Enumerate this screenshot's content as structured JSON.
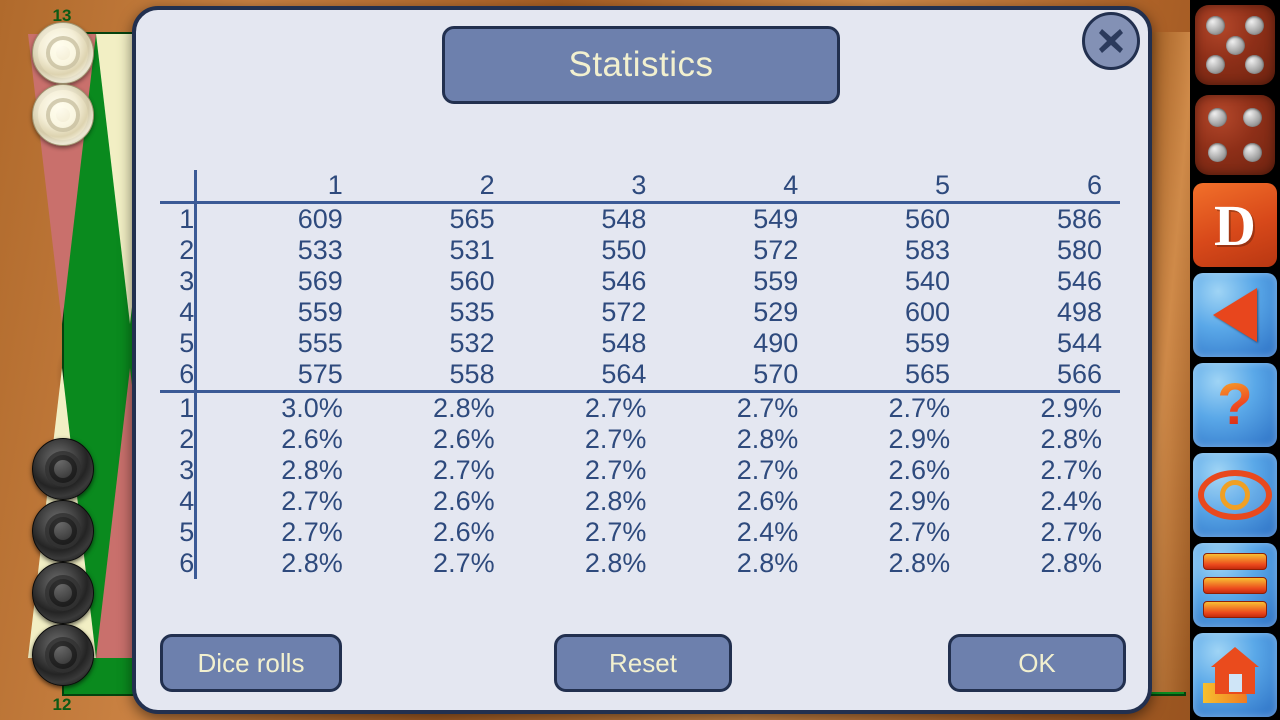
{
  "dialog": {
    "title": "Statistics",
    "close_icon": "close-x-icon"
  },
  "table": {
    "column_headers": [
      "1",
      "2",
      "3",
      "4",
      "5",
      "6"
    ],
    "row_headers": [
      "1",
      "2",
      "3",
      "4",
      "5",
      "6"
    ],
    "counts": [
      [
        "609",
        "565",
        "548",
        "549",
        "560",
        "586"
      ],
      [
        "533",
        "531",
        "550",
        "572",
        "583",
        "580"
      ],
      [
        "569",
        "560",
        "546",
        "559",
        "540",
        "546"
      ],
      [
        "559",
        "535",
        "572",
        "529",
        "600",
        "498"
      ],
      [
        "555",
        "532",
        "548",
        "490",
        "559",
        "544"
      ],
      [
        "575",
        "558",
        "564",
        "570",
        "565",
        "566"
      ]
    ],
    "percents": [
      [
        "3.0%",
        "2.8%",
        "2.7%",
        "2.7%",
        "2.7%",
        "2.9%"
      ],
      [
        "2.6%",
        "2.6%",
        "2.7%",
        "2.8%",
        "2.9%",
        "2.8%"
      ],
      [
        "2.8%",
        "2.7%",
        "2.7%",
        "2.7%",
        "2.6%",
        "2.7%"
      ],
      [
        "2.7%",
        "2.6%",
        "2.8%",
        "2.6%",
        "2.9%",
        "2.4%"
      ],
      [
        "2.7%",
        "2.6%",
        "2.7%",
        "2.4%",
        "2.7%",
        "2.7%"
      ],
      [
        "2.8%",
        "2.7%",
        "2.8%",
        "2.8%",
        "2.8%",
        "2.8%"
      ]
    ]
  },
  "footer": {
    "dice_rolls_label": "Dice rolls",
    "reset_label": "Reset",
    "ok_label": "OK"
  },
  "board": {
    "point_labels": {
      "top": "13",
      "bottom": "12"
    },
    "white_checkers": 2,
    "black_checkers": 4
  },
  "toolbar": {
    "die_left_value": "5",
    "die_right_value": "4",
    "double_label": "D",
    "undo_icon": "triangle-left-icon",
    "help_label": "?",
    "eye_icon": "eye-icon",
    "menu_icon": "menu-bars-icon",
    "home_icon": "home-icon"
  },
  "colors": {
    "dialog_bg": "#e4e7f1",
    "dialog_border": "#22304f",
    "plate_bg": "#6d80ad",
    "plate_text": "#f2f0cf",
    "table_text": "#2e4a7d",
    "rule_line": "#3b5a96",
    "felt_green": "#0a8a1e",
    "point_red": "#c9706c",
    "point_cream": "#f2efc4"
  }
}
